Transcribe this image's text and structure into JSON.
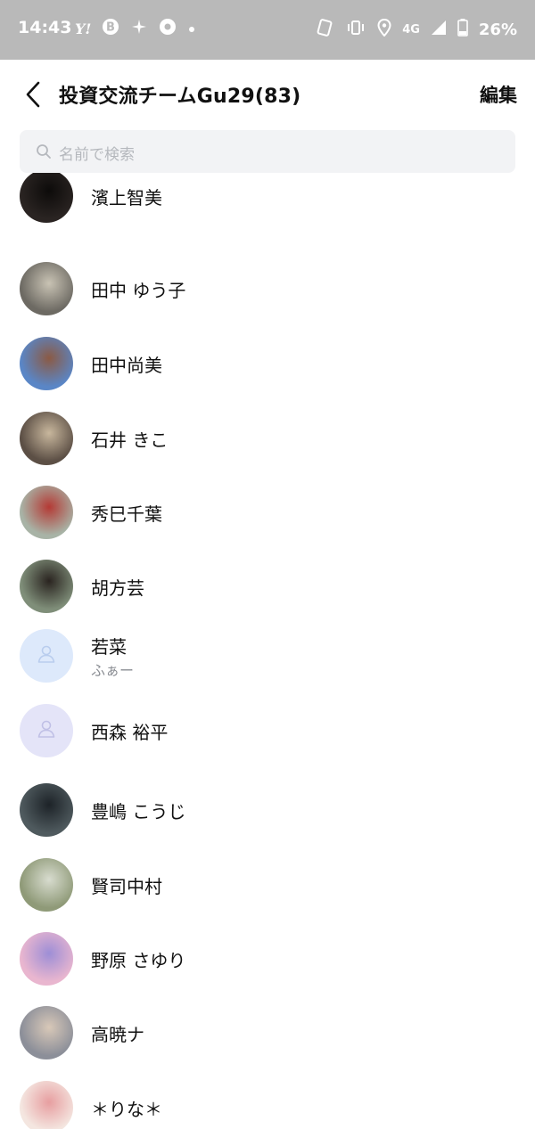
{
  "status_bar": {
    "time": "14:43",
    "network": "4G",
    "battery": "26%",
    "left_icons": [
      "yahoo-icon",
      "b-app-icon",
      "sparkle-icon",
      "chrome-icon",
      "dot-icon"
    ],
    "right_icons": [
      "nfc-icon",
      "vibrate-icon",
      "location-icon",
      "signal-icon",
      "battery-icon"
    ]
  },
  "header": {
    "title": "投資交流チームGu29(83)",
    "edit_label": "編集"
  },
  "search": {
    "placeholder": "名前で検索"
  },
  "members": [
    {
      "name": "濱上智美",
      "status": "",
      "avatar_color": "#2a2422",
      "avatar_accent": "#0d0b0a"
    },
    {
      "name": "田中 ゆう子",
      "status": "",
      "avatar_color": "#6d6a63",
      "avatar_accent": "#c9c3b4"
    },
    {
      "name": "田中尚美",
      "status": "",
      "avatar_color": "#5a86c6",
      "avatar_accent": "#8b5a44"
    },
    {
      "name": "石井 きこ",
      "status": "",
      "avatar_color": "#5c4f45",
      "avatar_accent": "#c8b79d"
    },
    {
      "name": "秀巳千葉",
      "status": "",
      "avatar_color": "#a8b3a6",
      "avatar_accent": "#b43a35"
    },
    {
      "name": "胡方芸",
      "status": "",
      "avatar_color": "#7f8e79",
      "avatar_accent": "#2a2420"
    },
    {
      "name": "若菜",
      "status": "ふぁー",
      "avatar_color": "#dde9fb",
      "avatar_accent": "#b9cdee"
    },
    {
      "name": "西森 裕平",
      "status": "",
      "avatar_color": "#e4e4f8",
      "avatar_accent": "#c0c0e6"
    },
    {
      "name": "豊嶋 こうじ",
      "status": "",
      "avatar_color": "#4f5a5e",
      "avatar_accent": "#1d2328"
    },
    {
      "name": "賢司中村",
      "status": "",
      "avatar_color": "#8f9a78",
      "avatar_accent": "#d8dccf"
    },
    {
      "name": "野原 さゆり",
      "status": "",
      "avatar_color": "#e9b6cf",
      "avatar_accent": "#9d8ed6"
    },
    {
      "name": "高暁ナ",
      "status": "",
      "avatar_color": "#8c8f99",
      "avatar_accent": "#d8c8b8"
    },
    {
      "name": "＊りな＊",
      "status": "",
      "avatar_color": "#f4e6e0",
      "avatar_accent": "#e79ea0"
    }
  ],
  "colors": {
    "status_bar_bg": "#b9b9b9",
    "search_bg": "#f2f3f5",
    "placeholder_text": "#b5b8bd",
    "secondary_text": "#8a8d93"
  }
}
